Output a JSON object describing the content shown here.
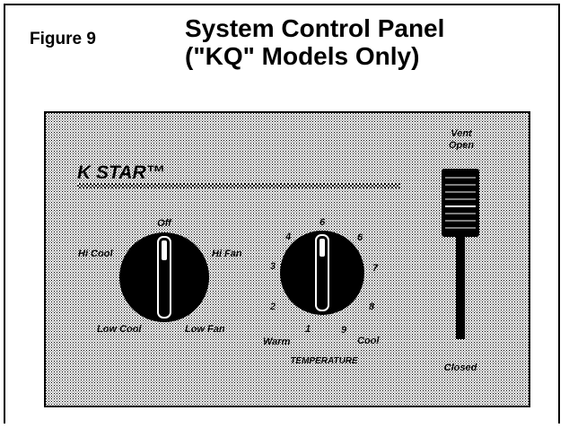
{
  "figure_label": "Figure 9",
  "title": {
    "line1": "System Control Panel",
    "line2": "(\"KQ\" Models Only)"
  },
  "panel": {
    "brand": "K STAR™",
    "mode_knob": {
      "labels": {
        "off": "Off",
        "hi_cool": "Hi Cool",
        "hi_fan": "Hi Fan",
        "low_cool": "Low Cool",
        "low_fan": "Low Fan"
      }
    },
    "temperature_knob": {
      "numbers": [
        "1",
        "2",
        "3",
        "4",
        "6",
        "6",
        "7",
        "8",
        "9"
      ],
      "warm": "Warm",
      "cool": "Cool",
      "caption": "TEMPERATURE"
    },
    "vent": {
      "open_line1": "Vent",
      "open_line2": "Open",
      "closed": "Closed"
    }
  },
  "colors": {
    "panel_background": "#e4e4e4",
    "knob": "#000000",
    "ink": "#000000"
  }
}
